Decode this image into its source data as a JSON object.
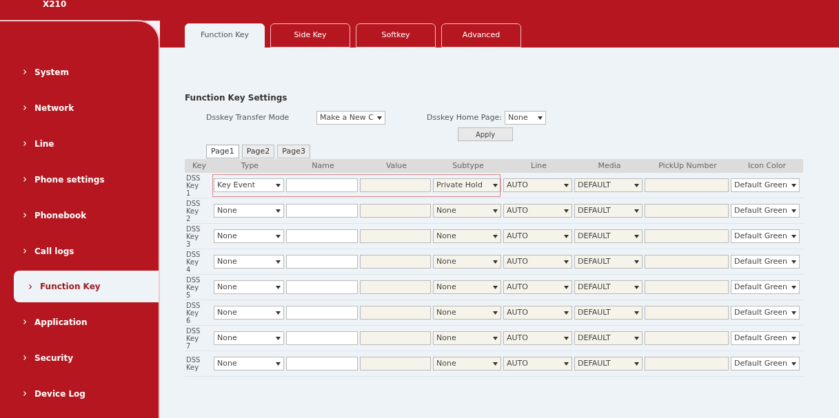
{
  "logo": "X210",
  "sidebar": {
    "items": [
      {
        "label": "System",
        "selected": false
      },
      {
        "label": "Network",
        "selected": false
      },
      {
        "label": "Line",
        "selected": false
      },
      {
        "label": "Phone settings",
        "selected": false
      },
      {
        "label": "Phonebook",
        "selected": false
      },
      {
        "label": "Call logs",
        "selected": false
      },
      {
        "label": "Function Key",
        "selected": true
      },
      {
        "label": "Application",
        "selected": false
      },
      {
        "label": "Security",
        "selected": false
      },
      {
        "label": "Device Log",
        "selected": false
      }
    ]
  },
  "tabs": [
    {
      "label": "Function Key",
      "selected": true
    },
    {
      "label": "Side Key",
      "selected": false
    },
    {
      "label": "Softkey",
      "selected": false
    },
    {
      "label": "Advanced",
      "selected": false
    }
  ],
  "section_title": "Function Key Settings",
  "transfer_mode": {
    "label": "Dsskey Transfer Mode",
    "value": "Make a New C"
  },
  "home_page": {
    "label": "Dsskey Home Page:",
    "value": "None"
  },
  "apply_button": "Apply",
  "pages": [
    {
      "label": "Page1",
      "selected": true
    },
    {
      "label": "Page2",
      "selected": false
    },
    {
      "label": "Page3",
      "selected": false
    }
  ],
  "table": {
    "columns": [
      "Key",
      "Type",
      "Name",
      "Value",
      "Subtype",
      "Line",
      "Media",
      "PickUp Number",
      "Icon Color"
    ],
    "rows": [
      {
        "key": "DSS Key 1",
        "type": "Key Event",
        "subtype": "Private Hold",
        "line": "AUTO",
        "media": "DEFAULT",
        "icon_color": "Default Green",
        "highlighted": true
      },
      {
        "key": "DSS Key 2",
        "type": "None",
        "subtype": "None",
        "line": "AUTO",
        "media": "DEFAULT",
        "icon_color": "Default Green",
        "highlighted": false
      },
      {
        "key": "DSS Key 3",
        "type": "None",
        "subtype": "None",
        "line": "AUTO",
        "media": "DEFAULT",
        "icon_color": "Default Green",
        "highlighted": false
      },
      {
        "key": "DSS Key 4",
        "type": "None",
        "subtype": "None",
        "line": "AUTO",
        "media": "DEFAULT",
        "icon_color": "Default Green",
        "highlighted": false
      },
      {
        "key": "DSS Key 5",
        "type": "None",
        "subtype": "None",
        "line": "AUTO",
        "media": "DEFAULT",
        "icon_color": "Default Green",
        "highlighted": false
      },
      {
        "key": "DSS Key 6",
        "type": "None",
        "subtype": "None",
        "line": "AUTO",
        "media": "DEFAULT",
        "icon_color": "Default Green",
        "highlighted": false
      },
      {
        "key": "DSS Key 7",
        "type": "None",
        "subtype": "None",
        "line": "AUTO",
        "media": "DEFAULT",
        "icon_color": "Default Green",
        "highlighted": false
      },
      {
        "key": "DSS Key",
        "type": "None",
        "subtype": "None",
        "line": "AUTO",
        "media": "DEFAULT",
        "icon_color": "Default Green",
        "highlighted": false
      }
    ]
  }
}
